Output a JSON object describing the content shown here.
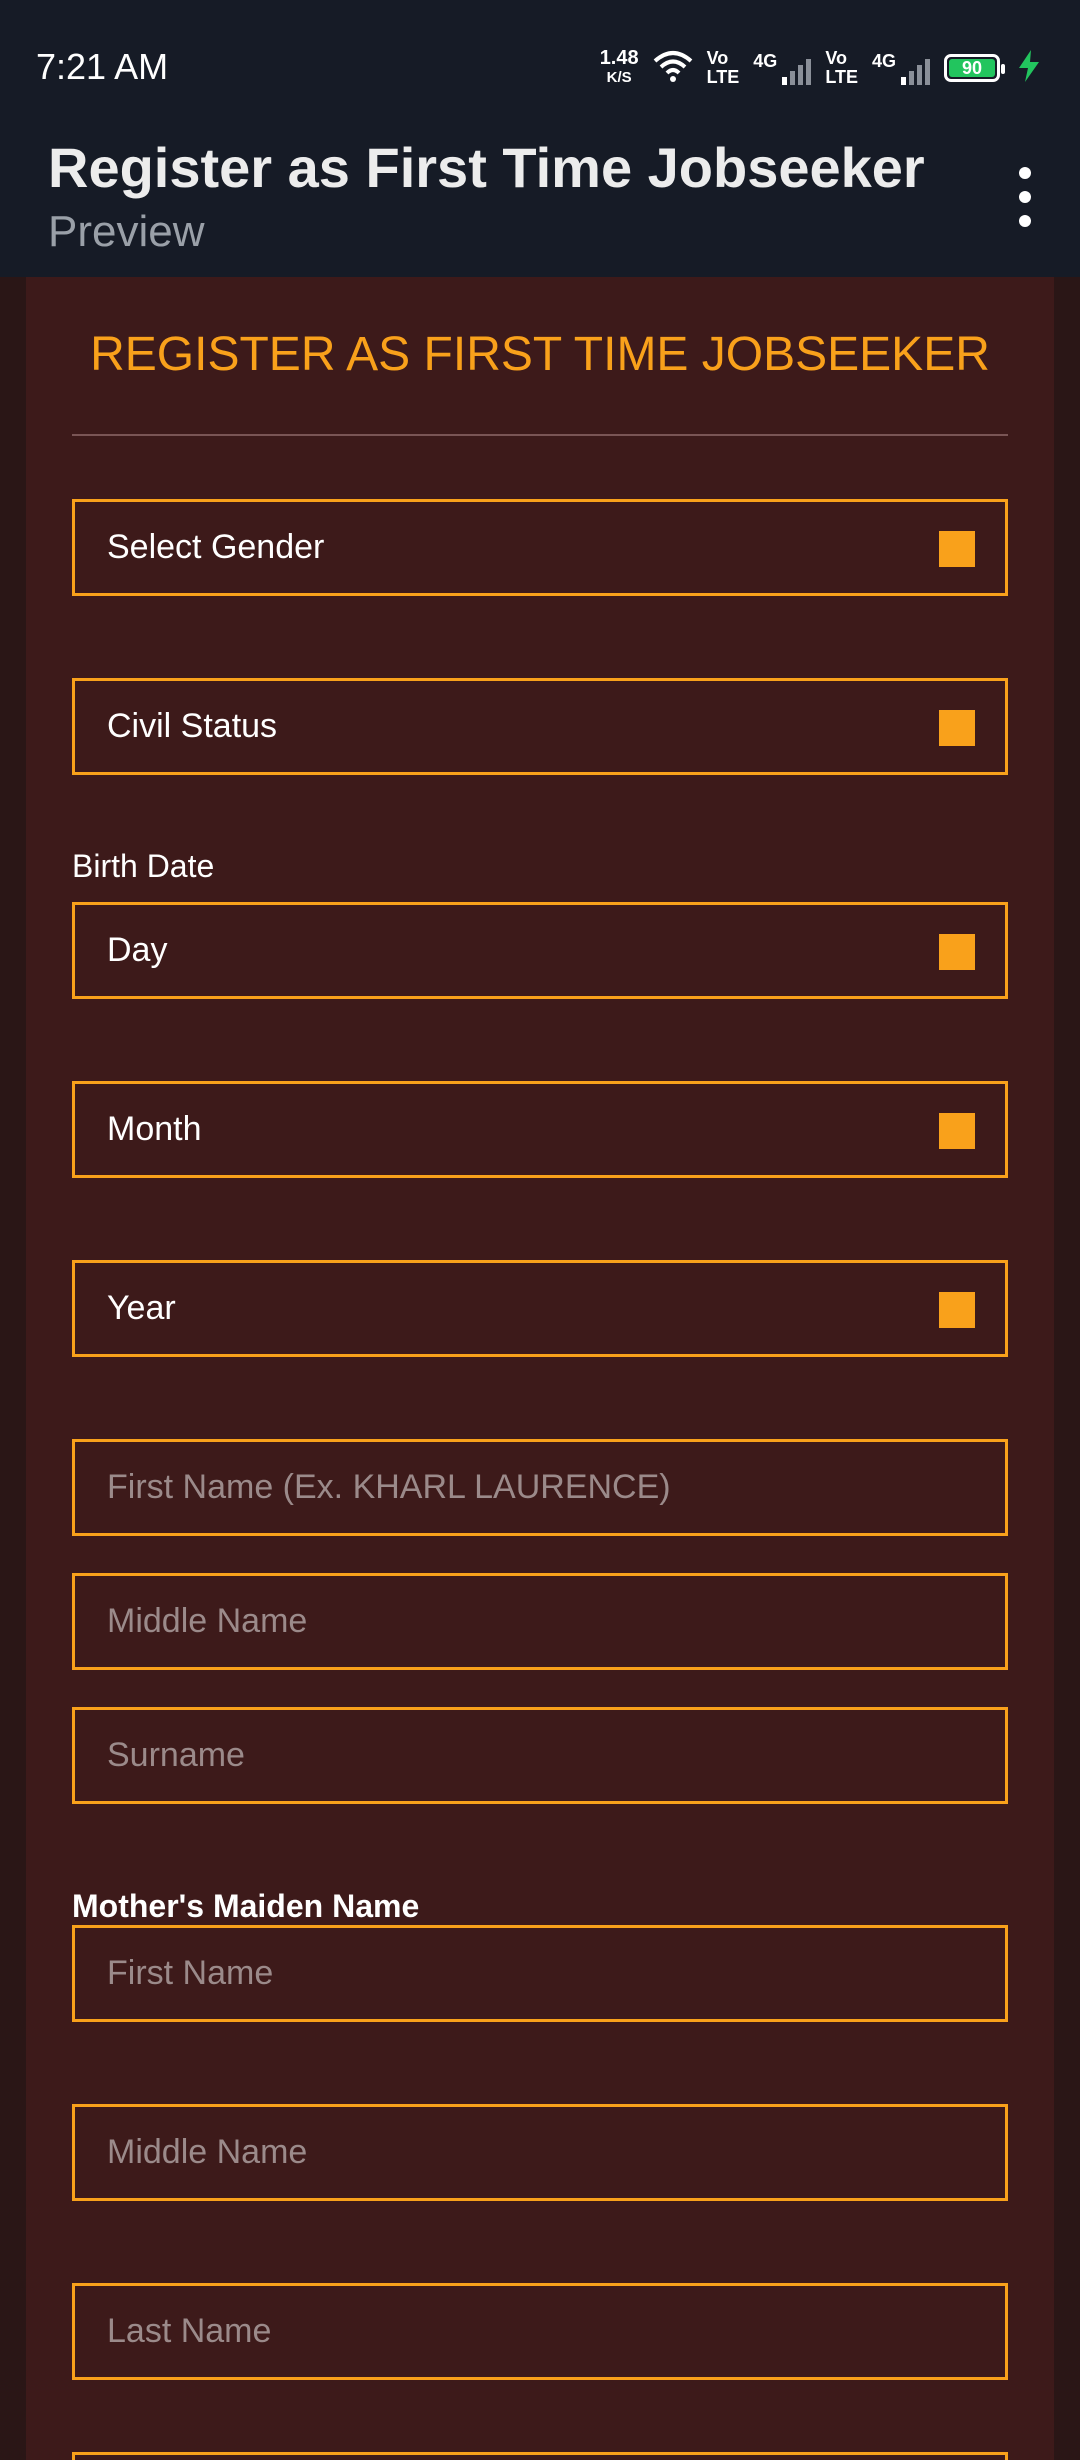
{
  "status_bar": {
    "time": "7:21 AM",
    "speed_value": "1.48",
    "speed_unit": "K/S",
    "net1_top": "Vo",
    "net1_bottom": "LTE",
    "sig1_label": "4G",
    "net2_top": "Vo",
    "net2_bottom": "LTE",
    "sig2_label": "4G",
    "battery": "90",
    "icons": [
      "wifi-icon",
      "signal-icon",
      "battery-icon",
      "charging-bolt-icon"
    ]
  },
  "app_bar": {
    "title": "Register as First Time Jobseeker",
    "subtitle": "Preview"
  },
  "form": {
    "heading": "REGISTER AS FIRST TIME JOBSEEKER",
    "gender": "Select Gender",
    "civil_status": "Civil Status",
    "birth_date_label": "Birth Date",
    "day": "Day",
    "month": "Month",
    "year": "Year",
    "first_name_placeholder": "First Name (Ex. KHARL LAURENCE)",
    "middle_name_placeholder": "Middle Name",
    "surname_placeholder": "Surname",
    "maiden_label": "Mother's Maiden Name",
    "maiden_first_placeholder": "First Name",
    "maiden_middle_placeholder": "Middle Name",
    "maiden_last_placeholder": "Last Name"
  },
  "colors": {
    "accent": "#f9a11b",
    "background": "#3d1a1a",
    "bar": "#161b26",
    "battery": "#22c55e"
  }
}
